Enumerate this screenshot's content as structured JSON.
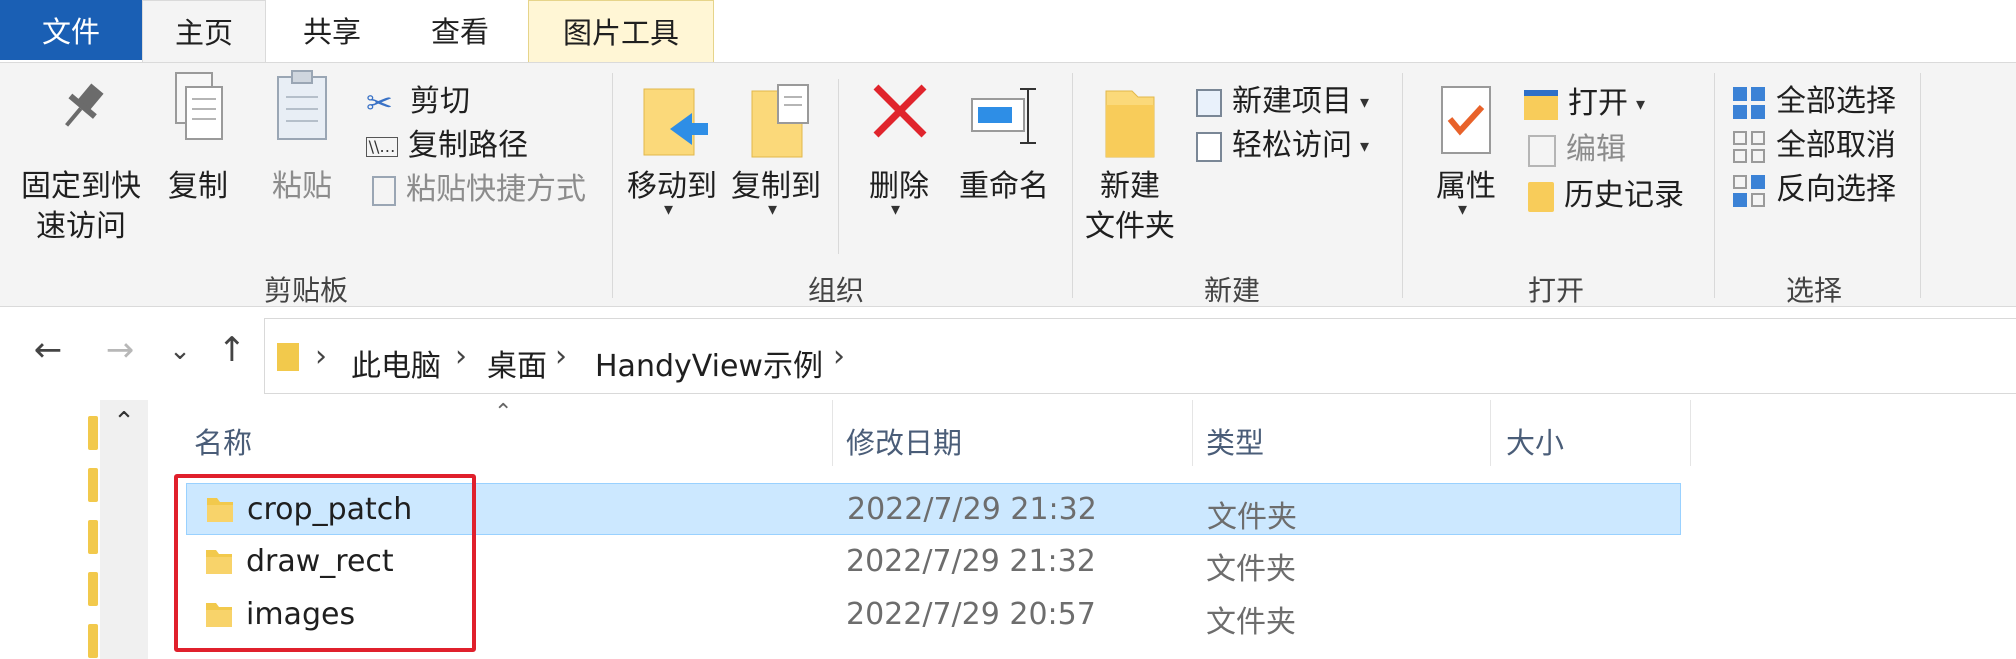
{
  "tabs": {
    "file": "文件",
    "home": "主页",
    "share": "共享",
    "view": "查看",
    "picture_tools": "图片工具"
  },
  "ribbon": {
    "clipboard": {
      "title": "剪贴板",
      "pin_line1": "固定到快",
      "pin_line2": "速访问",
      "copy": "复制",
      "paste": "粘贴",
      "cut": "剪切",
      "copy_path": "复制路径",
      "paste_shortcut": "粘贴快捷方式"
    },
    "organize": {
      "title": "组织",
      "move_to": "移动到",
      "copy_to": "复制到",
      "delete": "删除",
      "rename": "重命名"
    },
    "new": {
      "title": "新建",
      "new_folder_line1": "新建",
      "new_folder_line2": "文件夹",
      "new_item": "新建项目",
      "easy_access": "轻松访问"
    },
    "open": {
      "title": "打开",
      "properties": "属性",
      "open": "打开",
      "edit": "编辑",
      "history": "历史记录"
    },
    "select": {
      "title": "选择",
      "select_all": "全部选择",
      "select_none": "全部取消",
      "invert": "反向选择"
    }
  },
  "address": {
    "crumbs": [
      "此电脑",
      "桌面",
      "HandyView示例"
    ]
  },
  "columns": {
    "name": "名称",
    "modified": "修改日期",
    "type": "类型",
    "size": "大小"
  },
  "files": [
    {
      "name": "crop_patch",
      "modified": "2022/7/29 21:32",
      "type": "文件夹",
      "selected": true
    },
    {
      "name": "draw_rect",
      "modified": "2022/7/29 21:32",
      "type": "文件夹",
      "selected": false
    },
    {
      "name": "images",
      "modified": "2022/7/29 20:57",
      "type": "文件夹",
      "selected": false
    }
  ],
  "colors": {
    "file_tab": "#1a5fb4",
    "picture_tools_tab": "#fff6d5",
    "selection": "#cce8ff",
    "highlight_box": "#e0202c",
    "folder": "#f2c94c"
  }
}
